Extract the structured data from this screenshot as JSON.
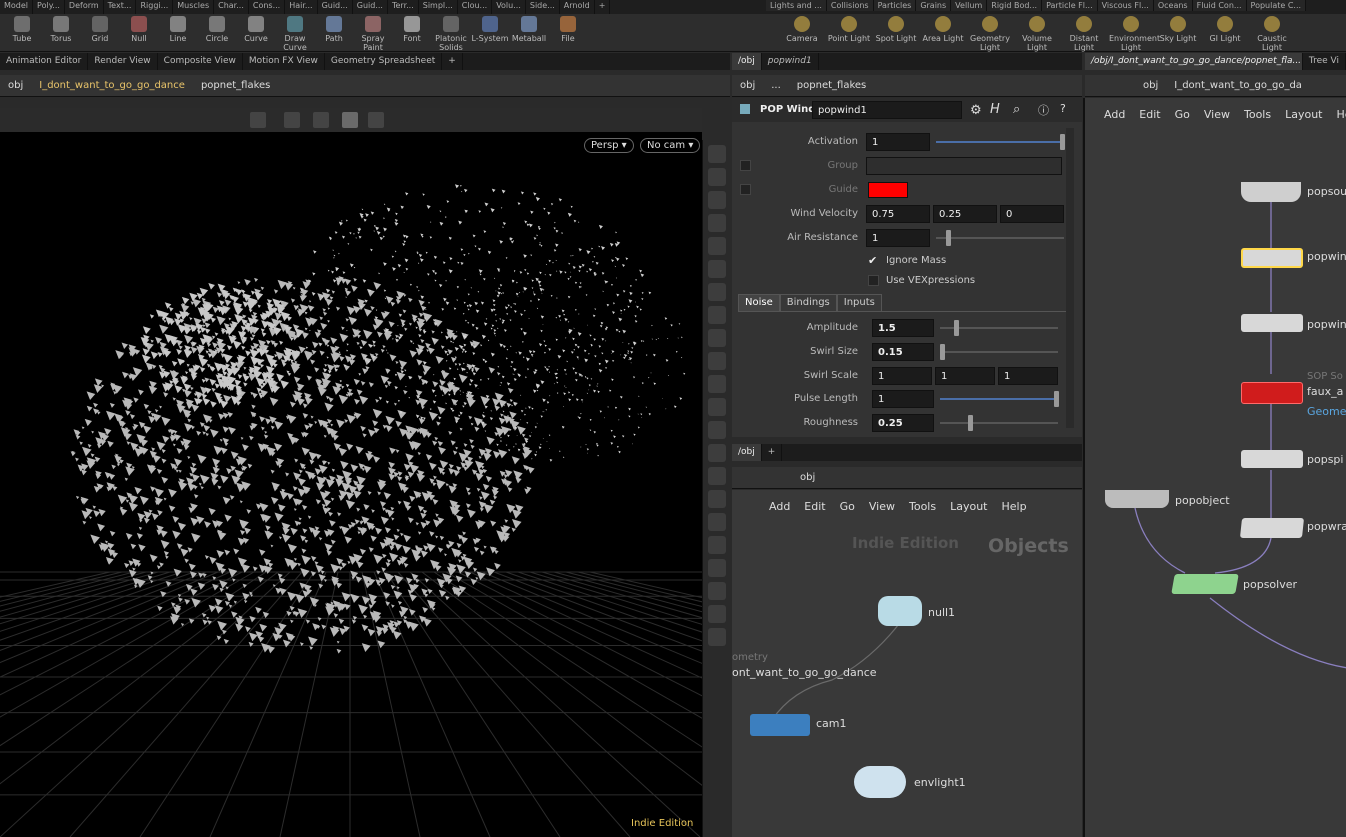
{
  "shelf_tabs_left": [
    "Model",
    "Poly...",
    "Deform",
    "Text...",
    "Riggi...",
    "Muscles",
    "Char...",
    "Cons...",
    "Hair...",
    "Guid...",
    "Guid...",
    "Terr...",
    "Simpl...",
    "Clou...",
    "Volu...",
    "Side...",
    "Arnold",
    "+"
  ],
  "shelf_tabs_right": [
    "Lights and ...",
    "Collisions",
    "Particles",
    "Grains",
    "Vellum",
    "Rigid Bod...",
    "Particle Fl...",
    "Viscous Fl...",
    "Oceans",
    "Fluid Con...",
    "Populate C..."
  ],
  "shelf_tools_left": [
    {
      "label": "Tube",
      "icon": "tube-icon"
    },
    {
      "label": "Torus",
      "icon": "torus-icon"
    },
    {
      "label": "Grid",
      "icon": "grid-icon"
    },
    {
      "label": "Null",
      "icon": "null-icon"
    },
    {
      "label": "Line",
      "icon": "line-icon"
    },
    {
      "label": "Circle",
      "icon": "circle-icon"
    },
    {
      "label": "Curve",
      "icon": "curve-icon"
    },
    {
      "label": "Draw Curve",
      "icon": "draw-curve-icon"
    },
    {
      "label": "Path",
      "icon": "path-icon"
    },
    {
      "label": "Spray Paint",
      "icon": "spray-paint-icon"
    },
    {
      "label": "Font",
      "icon": "font-icon"
    },
    {
      "label": "Platonic Solids",
      "icon": "platonic-icon"
    },
    {
      "label": "L-System",
      "icon": "lsystem-icon"
    },
    {
      "label": "Metaball",
      "icon": "metaball-icon"
    },
    {
      "label": "File",
      "icon": "file-icon"
    }
  ],
  "shelf_tools_right": [
    {
      "label": "Camera",
      "icon": "camera-icon"
    },
    {
      "label": "Point Light",
      "icon": "point-light-icon"
    },
    {
      "label": "Spot Light",
      "icon": "spot-light-icon"
    },
    {
      "label": "Area Light",
      "icon": "area-light-icon"
    },
    {
      "label": "Geometry Light",
      "icon": "geometry-light-icon"
    },
    {
      "label": "Volume Light",
      "icon": "volume-light-icon"
    },
    {
      "label": "Distant Light",
      "icon": "distant-light-icon"
    },
    {
      "label": "Environment Light",
      "icon": "environment-light-icon"
    },
    {
      "label": "Sky Light",
      "icon": "sky-light-icon"
    },
    {
      "label": "GI Light",
      "icon": "gi-light-icon"
    },
    {
      "label": "Caustic Light",
      "icon": "caustic-light-icon"
    }
  ],
  "viewer_tabs": [
    "Animation Editor",
    "Render View",
    "Composite View",
    "Motion FX View",
    "Geometry Spreadsheet",
    "+"
  ],
  "viewer_path": {
    "root": "obj",
    "geo": "I_dont_want_to_go_go_dance",
    "node": "popnet_flakes"
  },
  "viewport": {
    "persp": "Persp",
    "cam": "No cam",
    "edition": "Indie Edition"
  },
  "param_pane": {
    "tab": "/obj",
    "tab2": "popwind1",
    "path_root": "obj",
    "path_mid": "...",
    "path_node": "popnet_flakes",
    "node_type": "POP Wind",
    "node_name": "popwind1",
    "activation": {
      "label": "Activation",
      "value": "1"
    },
    "group": {
      "label": "Group"
    },
    "guide": {
      "label": "Guide",
      "color": "#ff0000"
    },
    "wind_velocity": {
      "label": "Wind Velocity",
      "x": "0.75",
      "y": "0.25",
      "z": "0"
    },
    "air_resistance": {
      "label": "Air Resistance",
      "value": "1"
    },
    "ignore_mass": "Ignore Mass",
    "use_vex": "Use VEXpressions",
    "subtabs": [
      "Noise",
      "Bindings",
      "Inputs"
    ],
    "amplitude": {
      "label": "Amplitude",
      "value": "1.5"
    },
    "swirl_size": {
      "label": "Swirl Size",
      "value": "0.15"
    },
    "swirl_scale": {
      "label": "Swirl Scale",
      "x": "1",
      "y": "1",
      "z": "1"
    },
    "pulse_length": {
      "label": "Pulse Length",
      "value": "1"
    },
    "roughness": {
      "label": "Roughness",
      "value": "0.25"
    }
  },
  "net_pane": {
    "tab": "/obj",
    "path": "obj",
    "menu": [
      "Add",
      "Edit",
      "Go",
      "View",
      "Tools",
      "Layout",
      "Help"
    ],
    "watermark_edition": "Indie Edition",
    "watermark_context": "Objects",
    "nodes": {
      "null": "null1",
      "geo_type": "ometry",
      "geo": "ont_want_to_go_go_dance",
      "cam": "cam1",
      "env": "envlight1"
    }
  },
  "right_pane": {
    "tab": "/obj/I_dont_want_to_go_go_dance/popnet_fla...",
    "tab2": "Tree Vi",
    "path_root": "obj",
    "path_node": "I_dont_want_to_go_go_da",
    "menu": [
      "Add",
      "Edit",
      "Go",
      "View",
      "Tools",
      "Layout",
      "He"
    ],
    "nodes": {
      "source": "popsou",
      "wind1": "popwin",
      "wind2": "popwin",
      "sop_solver_type": "SOP So",
      "faux": "faux_a",
      "geo_link": "Geomet",
      "spin": "popspi",
      "wrangle": "popwra",
      "object": "popobject",
      "solver": "popsolver"
    }
  }
}
